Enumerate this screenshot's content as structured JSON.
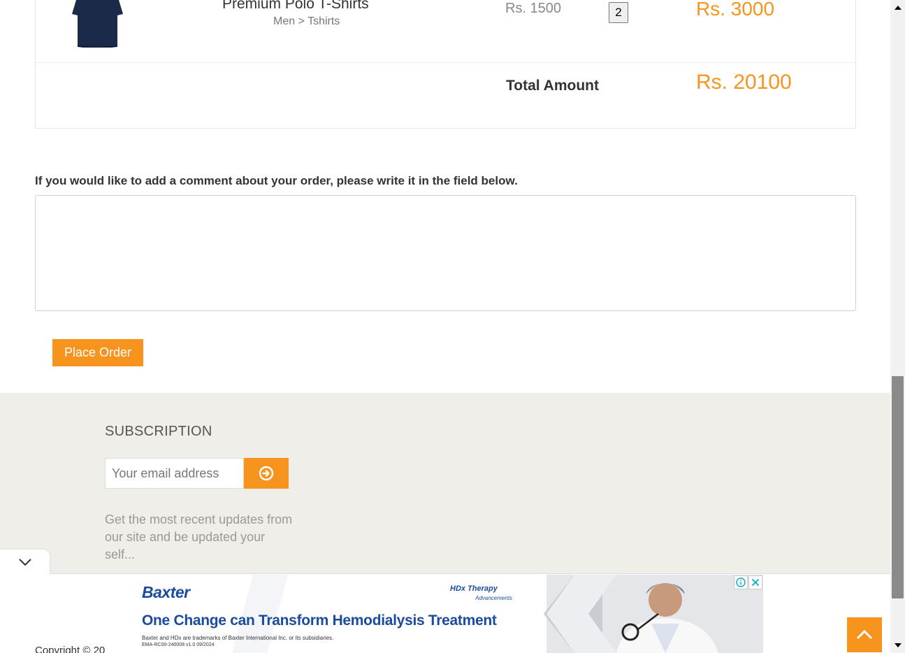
{
  "cart": {
    "product_name": "Premium Polo T-Shirts",
    "product_category": "Men > Tshirts",
    "unit_price": "Rs. 1500",
    "quantity": "2",
    "line_total": "Rs. 3000",
    "total_label": "Total Amount",
    "total_value": "Rs. 20100",
    "product_image_icon": "navy-polo-shirt-icon"
  },
  "comment": {
    "label": "If you would like to add a comment about your order, please write it in the field below.",
    "value": "",
    "placeholder": ""
  },
  "place_order": {
    "label": "Place Order"
  },
  "footer": {
    "subscription_title": "SUBSCRIPTION",
    "email_placeholder": "Your email address",
    "subscribe_icon": "arrow-circle-right-icon",
    "description": "Get the most recent updates from our site and be updated your self...",
    "copyright": "Copyright © 20"
  },
  "ad": {
    "brand": "Baxter",
    "product_logo": "HDx Therapy",
    "product_logo_sub": "Advancements",
    "headline": "One Change can Transform Hemodialysis Treatment",
    "fine_print_1": "Baxter and HDx are trademarks of Baxter International Inc. or its subsidiaries.",
    "fine_print_2": "EMA-RC00-240008 v1.0 09/2024"
  },
  "colors": {
    "accent": "#f7941d",
    "footer_bg": "#efeee8",
    "ad_brand": "#1a4b9c"
  }
}
